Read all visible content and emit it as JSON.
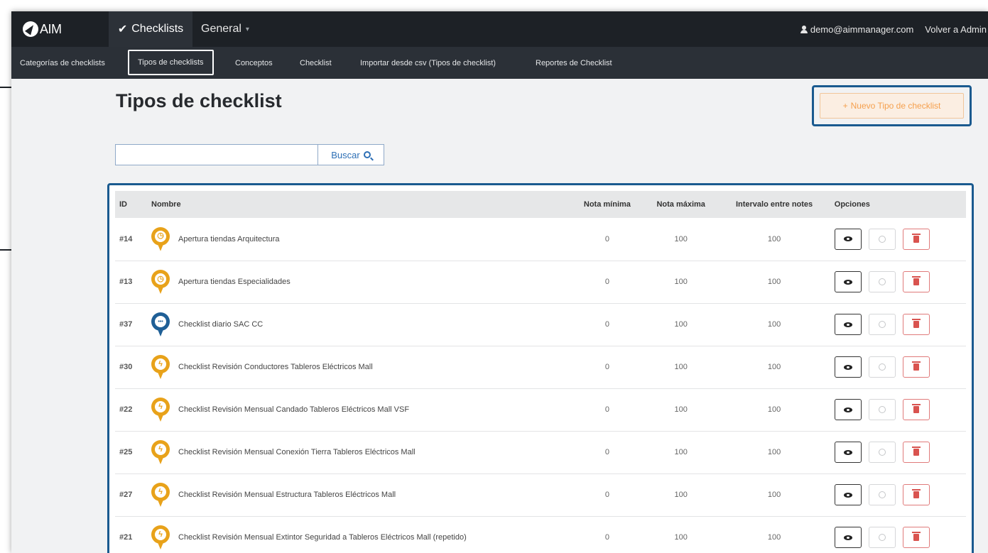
{
  "brand": {
    "name": "AIM"
  },
  "topnav": {
    "active_label": "Checklists",
    "general_label": "General",
    "user_email": "demo@aimmanager.com",
    "back_link": "Volver a Admin"
  },
  "subnav": {
    "items": [
      {
        "label": "Categorías de checklists"
      },
      {
        "label": "Tipos de checklists"
      },
      {
        "label": "Conceptos"
      },
      {
        "label": "Checklist"
      },
      {
        "label": "Importar desde csv (Tipos de checklist)"
      },
      {
        "label": "Reportes de Checklist"
      }
    ]
  },
  "page": {
    "title": "Tipos de checklist",
    "new_button": "Nuevo Tipo de checklist"
  },
  "search": {
    "value": "",
    "button_label": "Buscar"
  },
  "table": {
    "headers": {
      "id": "ID",
      "name": "Nombre",
      "min": "Nota mínima",
      "max": "Nota máxima",
      "interval": "Intervalo entre notes",
      "options": "Opciones"
    },
    "rows": [
      {
        "id": "#14",
        "name": "Apertura tiendas Arquitectura",
        "min": "0",
        "max": "100",
        "interval": "100",
        "icon": "clock-pin-icon",
        "color": "#e8a21a"
      },
      {
        "id": "#13",
        "name": "Apertura tiendas Especialidades",
        "min": "0",
        "max": "100",
        "interval": "100",
        "icon": "clock-pin-icon",
        "color": "#e8a21a"
      },
      {
        "id": "#37",
        "name": "Checklist diario SAC CC",
        "min": "0",
        "max": "100",
        "interval": "100",
        "icon": "chat-pin-icon",
        "color": "#1f5f96"
      },
      {
        "id": "#30",
        "name": "Checklist Revisión Conductores Tableros Eléctricos Mall",
        "min": "0",
        "max": "100",
        "interval": "100",
        "icon": "bolt-pin-icon",
        "color": "#e8a21a"
      },
      {
        "id": "#22",
        "name": "Checklist Revisión Mensual Candado Tableros Eléctricos Mall VSF",
        "min": "0",
        "max": "100",
        "interval": "100",
        "icon": "bolt-pin-icon",
        "color": "#e8a21a"
      },
      {
        "id": "#25",
        "name": "Checklist Revisión Mensual Conexión Tierra Tableros Eléctricos Mall",
        "min": "0",
        "max": "100",
        "interval": "100",
        "icon": "bolt-pin-icon",
        "color": "#e8a21a"
      },
      {
        "id": "#27",
        "name": "Checklist Revisión Mensual Estructura Tableros Eléctricos Mall",
        "min": "0",
        "max": "100",
        "interval": "100",
        "icon": "bolt-pin-icon",
        "color": "#e8a21a"
      },
      {
        "id": "#21",
        "name": "Checklist Revisión Mensual Extintor Seguridad a Tableros Eléctricos Mall (repetido)",
        "min": "0",
        "max": "100",
        "interval": "100",
        "icon": "bolt-pin-icon",
        "color": "#e8a21a"
      }
    ]
  },
  "colors": {
    "accent_orange": "#f5a04e",
    "highlight_blue": "#1a5a8f",
    "topbar": "#1d2126"
  }
}
